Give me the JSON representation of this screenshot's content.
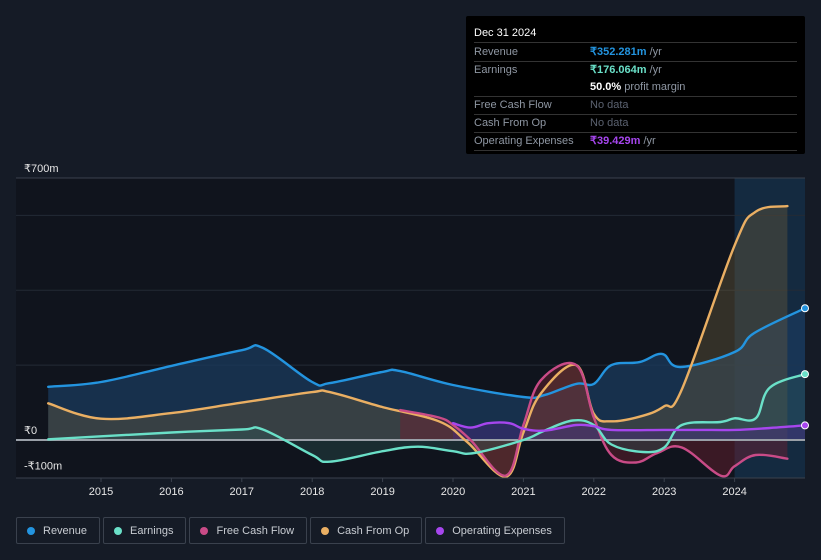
{
  "tooltip": {
    "date": "Dec 31 2024",
    "rows": [
      {
        "label": "Revenue",
        "value": "₹352.281m",
        "unit": " /yr",
        "color": "#2394df"
      },
      {
        "label": "Earnings",
        "value": "₹176.064m",
        "unit": " /yr",
        "color": "#6ae0c8"
      },
      {
        "label": "",
        "value": "50.0%",
        "unit": " profit margin",
        "color": "#ffffff"
      },
      {
        "label": "Free Cash Flow",
        "value": "No data",
        "unit": "",
        "color": "#5b6270"
      },
      {
        "label": "Cash From Op",
        "value": "No data",
        "unit": "",
        "color": "#5b6270"
      },
      {
        "label": "Operating Expenses",
        "value": "₹39.429m",
        "unit": " /yr",
        "color": "#a646ee"
      }
    ]
  },
  "legend": [
    {
      "label": "Revenue",
      "color": "#2394df"
    },
    {
      "label": "Earnings",
      "color": "#6ae0c8"
    },
    {
      "label": "Free Cash Flow",
      "color": "#c94b87"
    },
    {
      "label": "Cash From Op",
      "color": "#eaaf63"
    },
    {
      "label": "Operating Expenses",
      "color": "#a646ee"
    }
  ],
  "chart_data": {
    "type": "line",
    "title": "",
    "xlabel": "",
    "ylabel": "",
    "y_tick_labels": [
      "₹700m",
      "₹0",
      "-₹100m"
    ],
    "y_ticks": [
      700,
      0,
      -100
    ],
    "ylim": [
      -100,
      700
    ],
    "x_tick_labels": [
      "2015",
      "2016",
      "2017",
      "2018",
      "2019",
      "2020",
      "2021",
      "2022",
      "2023",
      "2024"
    ],
    "x_ticks": [
      2015,
      2016,
      2017,
      2018,
      2019,
      2020,
      2021,
      2022,
      2023,
      2024
    ],
    "xlim": [
      2014.25,
      2025.0
    ],
    "gridlines": [
      600,
      400,
      200
    ],
    "highlight_start": 2024.0,
    "series": [
      {
        "name": "Revenue",
        "color": "#2394df",
        "x": [
          2014.25,
          2015.0,
          2016.0,
          2017.0,
          2017.3,
          2018.0,
          2018.25,
          2019.0,
          2019.25,
          2020.0,
          2021.0,
          2021.3,
          2021.75,
          2022.0,
          2022.25,
          2022.65,
          2022.97,
          2023.23,
          2024.0,
          2024.28,
          2025.0
        ],
        "y": [
          142,
          155,
          198,
          240,
          246,
          155,
          152,
          182,
          184,
          147,
          115,
          120,
          150,
          150,
          200,
          208,
          230,
          195,
          235,
          286,
          352
        ]
      },
      {
        "name": "Earnings",
        "color": "#6ae0c8",
        "x": [
          2014.25,
          2015.0,
          2016.0,
          2017.0,
          2017.3,
          2018.0,
          2018.25,
          2019.0,
          2019.5,
          2020.0,
          2020.3,
          2021.0,
          2021.3,
          2021.7,
          2022.0,
          2022.25,
          2022.7,
          2023.0,
          2023.25,
          2023.8,
          2024.0,
          2024.3,
          2024.5,
          2025.0
        ],
        "y": [
          2,
          10,
          20,
          28,
          28,
          -40,
          -58,
          -30,
          -18,
          -30,
          -35,
          0,
          25,
          52,
          40,
          -12,
          -32,
          -20,
          40,
          48,
          58,
          58,
          140,
          176
        ]
      },
      {
        "name": "Free Cash Flow",
        "color": "#c94b87",
        "x": [
          2019.25,
          2019.8,
          2020.0,
          2020.25,
          2020.75,
          2021.0,
          2021.25,
          2021.75,
          2022.0,
          2022.25,
          2022.6,
          2022.9,
          2023.25,
          2023.8,
          2024.0,
          2024.3,
          2024.75
        ],
        "y": [
          80,
          60,
          40,
          0,
          -95,
          40,
          160,
          200,
          60,
          -40,
          -60,
          -35,
          -20,
          -95,
          -70,
          -40,
          -50
        ]
      },
      {
        "name": "Cash From Op",
        "color": "#eaaf63",
        "x": [
          2014.25,
          2015.0,
          2016.0,
          2017.0,
          2018.0,
          2018.25,
          2019.0,
          2019.8,
          2020.2,
          2020.75,
          2021.0,
          2021.25,
          2021.75,
          2022.0,
          2022.25,
          2022.7,
          2023.0,
          2023.25,
          2024.0,
          2024.3,
          2024.75
        ],
        "y": [
          98,
          57,
          72,
          100,
          128,
          128,
          88,
          50,
          -5,
          -98,
          20,
          125,
          200,
          70,
          50,
          65,
          90,
          135,
          520,
          610,
          625
        ]
      },
      {
        "name": "Operating Expenses",
        "color": "#a646ee",
        "x": [
          2020.0,
          2020.25,
          2020.5,
          2020.8,
          2021.0,
          2021.3,
          2021.75,
          2022.0,
          2022.25,
          2023.0,
          2023.5,
          2024.0,
          2024.5,
          2025.0
        ],
        "y": [
          45,
          33,
          45,
          45,
          30,
          25,
          40,
          37,
          27,
          27,
          27,
          27,
          32,
          39
        ]
      }
    ]
  }
}
